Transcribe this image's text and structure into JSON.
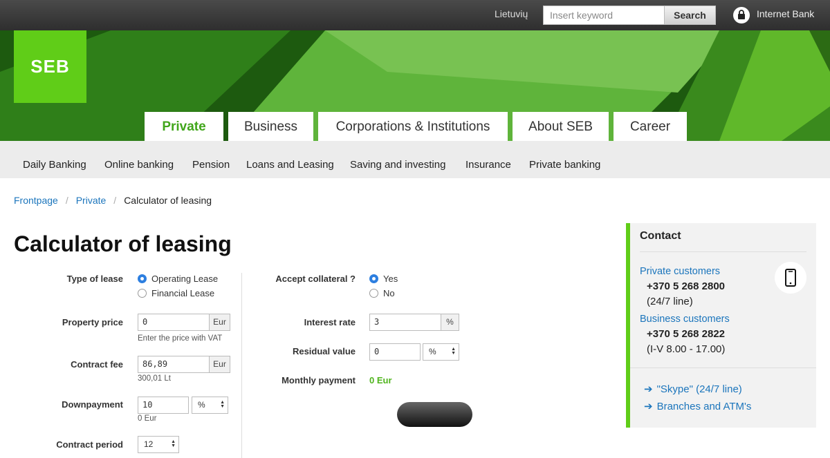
{
  "topbar": {
    "language": "Lietuvių",
    "search_placeholder": "Insert keyword",
    "search_button": "Search",
    "internet_bank": "Internet Bank"
  },
  "brand": {
    "logo": "SEB",
    "accent": "#60cd18",
    "link_color": "#1b75bc"
  },
  "main_tabs": [
    "Private",
    "Business",
    "Corporations & Institutions",
    "About SEB",
    "Career"
  ],
  "sub_nav": [
    "Daily Banking",
    "Online banking",
    "Pension",
    "Loans and Leasing",
    "Saving and investing",
    "Insurance",
    "Private banking"
  ],
  "breadcrumb": [
    "Frontpage",
    "Private",
    "Calculator of leasing"
  ],
  "page_title": "Calculator of leasing",
  "form": {
    "type_of_lease": {
      "label": "Type of lease",
      "options": [
        "Operating Lease",
        "Financial Lease"
      ],
      "selected": "Operating Lease"
    },
    "property_price": {
      "label": "Property price",
      "value": "0",
      "unit": "Eur",
      "hint": "Enter the price with VAT"
    },
    "contract_fee": {
      "label": "Contract fee",
      "value": "86,89",
      "unit": "Eur",
      "hint": "300,01 Lt"
    },
    "downpayment": {
      "label": "Downpayment",
      "value": "10",
      "unit": "%",
      "hint": "0 Eur"
    },
    "contract_period": {
      "label": "Contract period",
      "value": "12"
    },
    "accept_collateral": {
      "label": "Accept collateral ?",
      "options": [
        "Yes",
        "No"
      ],
      "selected": "Yes"
    },
    "interest_rate": {
      "label": "Interest rate",
      "value": "3",
      "unit": "%"
    },
    "residual_value": {
      "label": "Residual value",
      "value": "0",
      "unit": "%"
    },
    "monthly_payment": {
      "label": "Monthly payment",
      "value": "0 Eur"
    }
  },
  "contact": {
    "title": "Contact",
    "private_label": "Private customers",
    "private_phone": "+370 5 268 2800",
    "private_hours": "(24/7 line)",
    "business_label": "Business customers",
    "business_phone": "+370 5 268 2822",
    "business_hours": "(I-V 8.00 - 17.00)",
    "links": [
      "\"Skype\" (24/7 line)",
      "Branches and ATM's"
    ]
  }
}
